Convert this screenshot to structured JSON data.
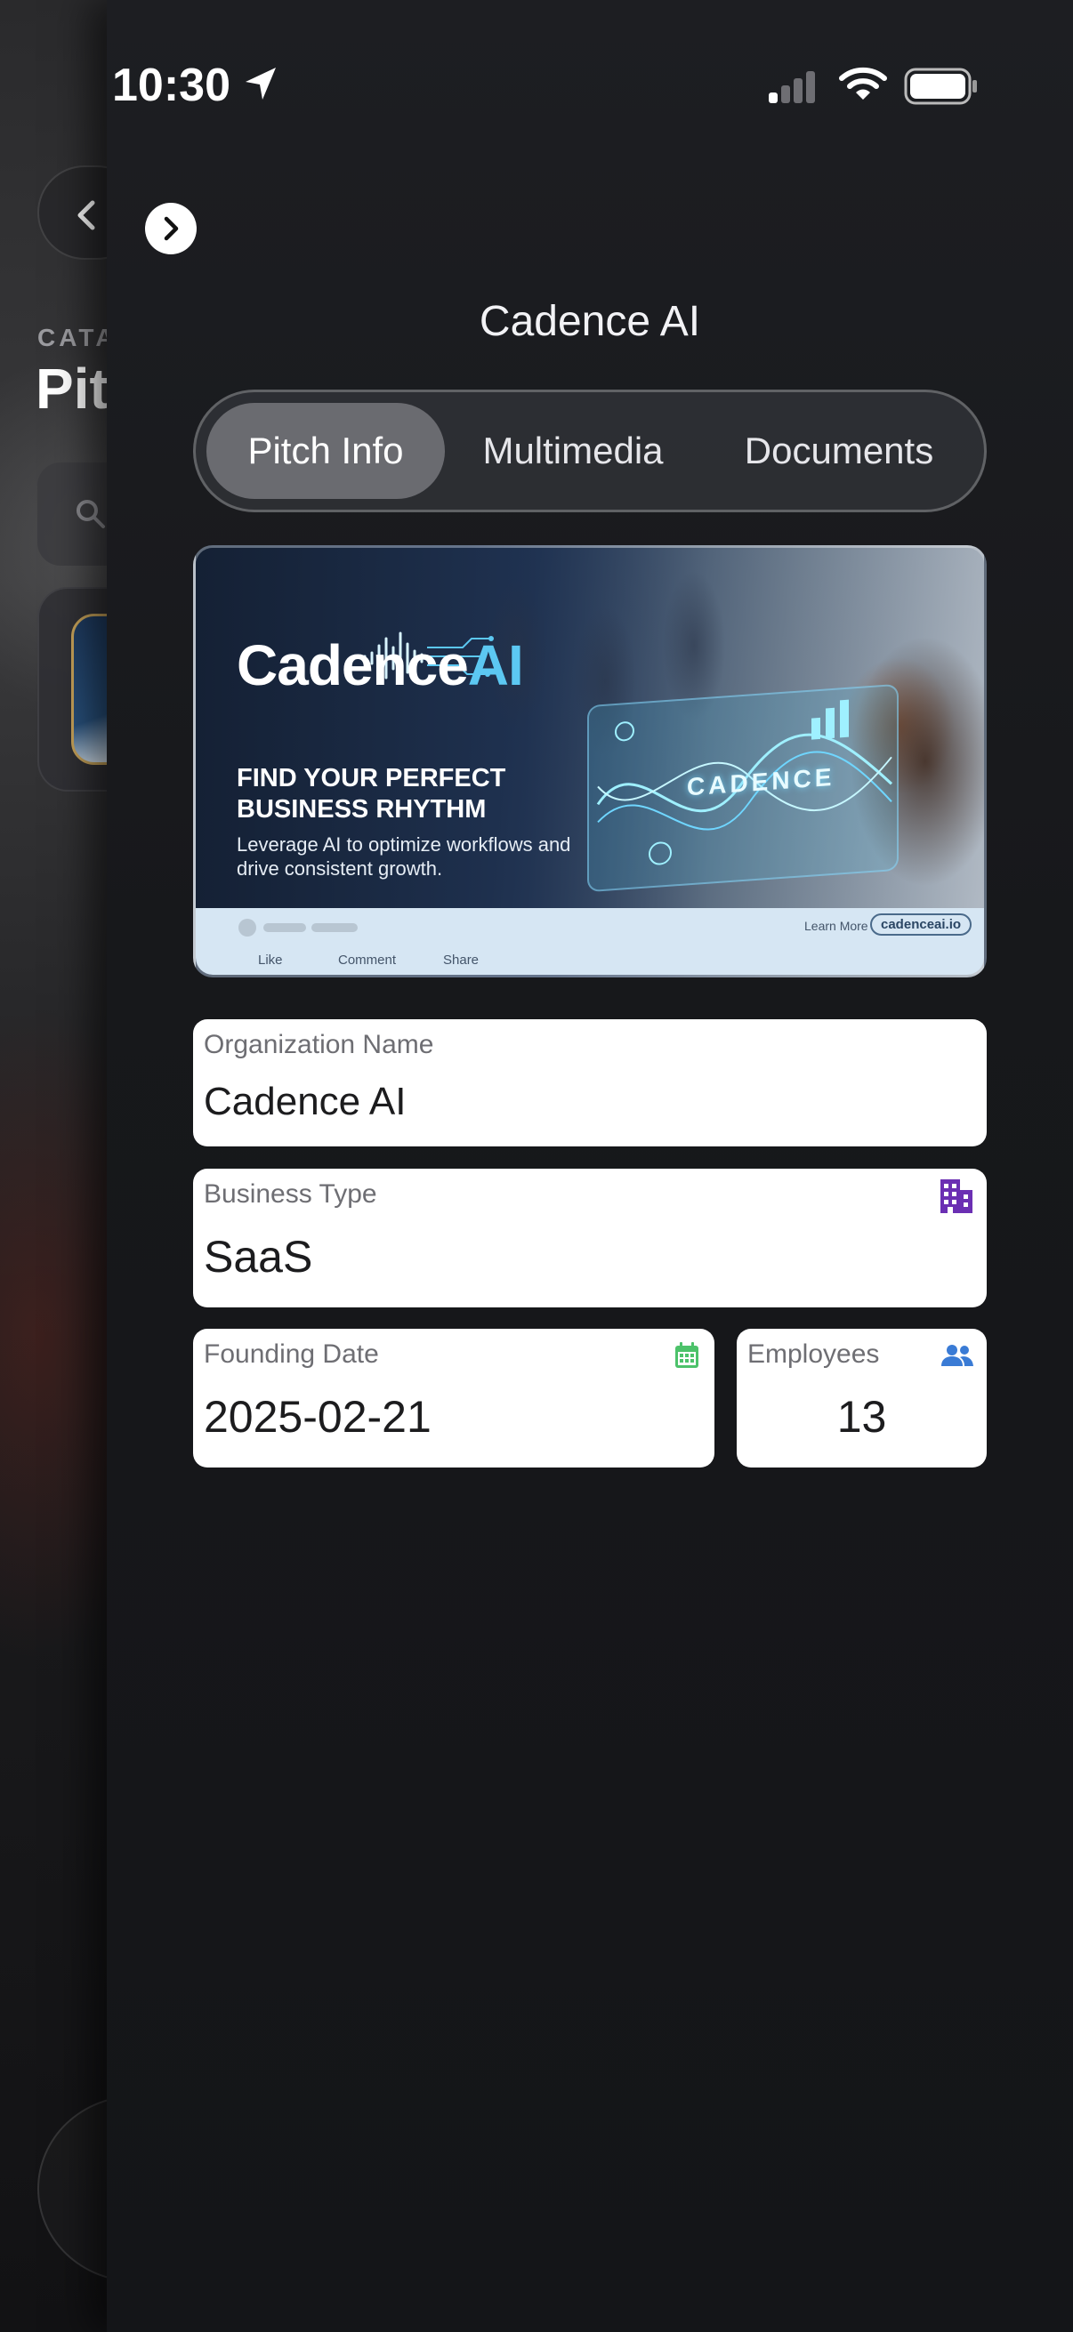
{
  "status_bar": {
    "time": "10:30"
  },
  "background": {
    "category_label": "CATA",
    "title": "Pit"
  },
  "panel": {
    "title": "Cadence AI",
    "tabs": [
      {
        "label": "Pitch Info",
        "active": true
      },
      {
        "label": "Multimedia",
        "active": false
      },
      {
        "label": "Documents",
        "active": false
      }
    ]
  },
  "banner": {
    "logo_main": "Cadence",
    "logo_accent": "AI",
    "headline": "FIND YOUR PERFECT BUSINESS RHYTHM",
    "subline": "Leverage AI to optimize workflows and drive consistent growth.",
    "holo_label": "CADENCE",
    "learn_more": "Learn More",
    "url": "cadenceai.io",
    "actions": {
      "like": "Like",
      "comment": "Comment",
      "share": "Share"
    }
  },
  "fields": {
    "organization_name": {
      "label": "Organization Name",
      "value": "Cadence AI"
    },
    "business_type": {
      "label": "Business Type",
      "value": "SaaS",
      "icon": "building-icon",
      "icon_color": "#6b2fb3"
    },
    "founding_date": {
      "label": "Founding Date",
      "value": "2025-02-21",
      "icon": "calendar-icon",
      "icon_color": "#4cc26a"
    },
    "employees": {
      "label": "Employees",
      "value": "13",
      "icon": "people-icon",
      "icon_color": "#3a7bd5"
    }
  }
}
